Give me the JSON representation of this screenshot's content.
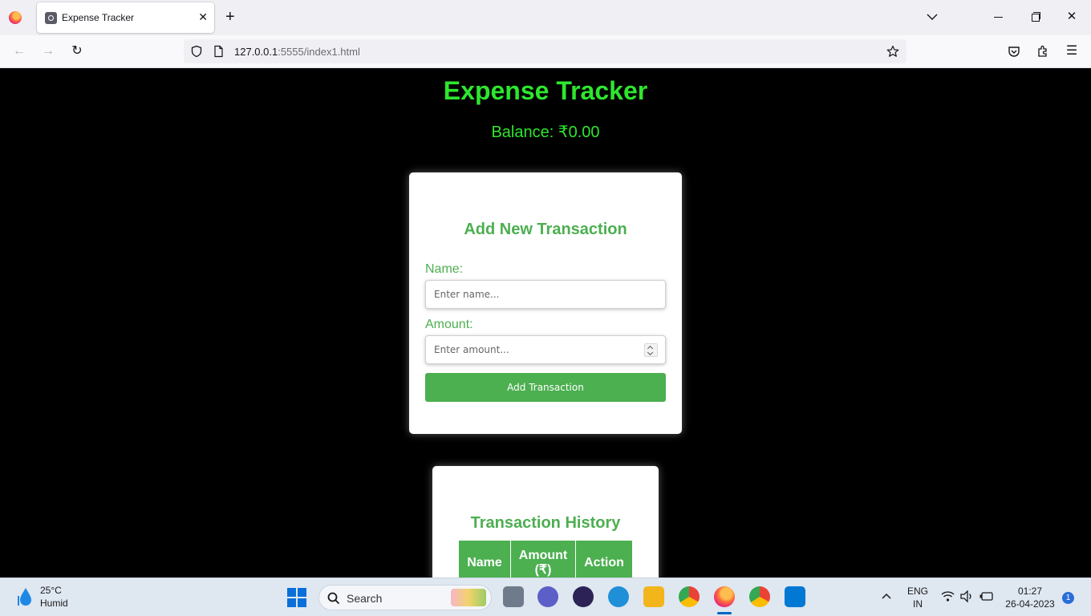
{
  "browser": {
    "tab_title": "Expense Tracker",
    "url_host": "127.0.0.1",
    "url_rest": ":5555/index1.html"
  },
  "page": {
    "title": "Expense Tracker",
    "balance_label": "Balance: ",
    "balance_value": "₹0.00"
  },
  "add_form": {
    "title": "Add New Transaction",
    "name_label": "Name:",
    "name_placeholder": "Enter name...",
    "amount_label": "Amount:",
    "amount_placeholder": "Enter amount...",
    "submit_label": "Add Transaction"
  },
  "history": {
    "title": "Transaction History",
    "columns": [
      "Name",
      "Amount (₹)",
      "Action"
    ]
  },
  "taskbar": {
    "weather_temp": "25°C",
    "weather_desc": "Humid",
    "search_label": "Search",
    "lang_top": "ENG",
    "lang_bottom": "IN",
    "time": "01:27",
    "date": "26-04-2023",
    "notifications": "1"
  },
  "colors": {
    "accent_green": "#4caf50",
    "heading_green": "#2ee62e",
    "page_bg": "#000000"
  }
}
